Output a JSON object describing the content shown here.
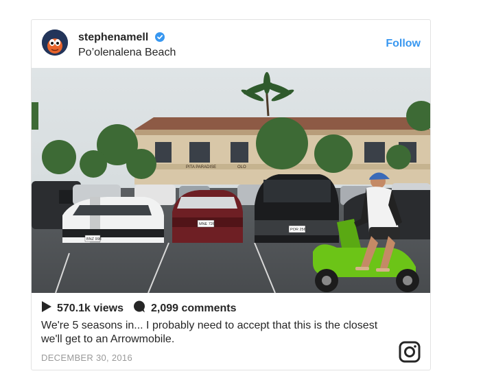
{
  "post": {
    "username": "stephenamell",
    "location": "Po’olenalena Beach",
    "follow_label": "Follow",
    "views": "570.1k views",
    "comments": "2,099 comments",
    "caption": "We're 5 seasons in... I probably need to accept that this is the closest we'll get to an Arrowmobile.",
    "date": "DECEMBER 30, 2016",
    "photo_signs": [
      "PITA PARADISE",
      "OLO"
    ],
    "plates": [
      "MNE 726",
      "POR 256",
      "BNZ 998"
    ]
  },
  "colors": {
    "follow": "#3897f0",
    "verified": "#3897f0",
    "scooter": "#6cc417",
    "date": "#999999",
    "border": "#e1e1e1"
  },
  "icons": [
    "verified-badge-icon",
    "play-icon",
    "comment-icon",
    "instagram-logo-icon"
  ]
}
